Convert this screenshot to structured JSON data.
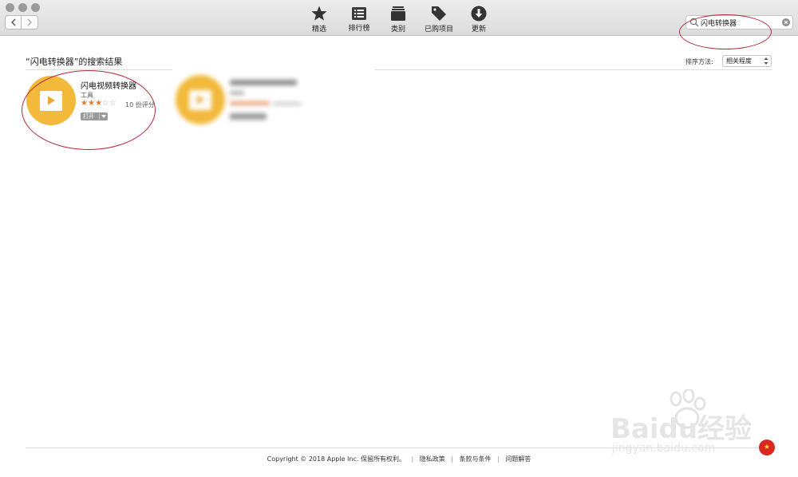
{
  "toolbar": {
    "items": [
      {
        "label": "精选",
        "icon": "star-icon"
      },
      {
        "label": "排行榜",
        "icon": "list-icon"
      },
      {
        "label": "类别",
        "icon": "stack-icon"
      },
      {
        "label": "已购项目",
        "icon": "tag-icon"
      },
      {
        "label": "更新",
        "icon": "download-icon"
      }
    ]
  },
  "search": {
    "value": "闪电转换器"
  },
  "results": {
    "title": "“闪电转换器”的搜索结果",
    "sort_label": "排序方法:",
    "sort_value": "相关程度"
  },
  "app": {
    "name": "闪电视频转换器",
    "category": "工具",
    "rating_stars": 3,
    "rating_max": 5,
    "rating_count": "10 份评分",
    "open_label": "打开",
    "icon": "play-icon",
    "icon_color": "#f2b93a"
  },
  "footer": {
    "copyright": "Copyright © 2018 Apple Inc. 保留所有权利。",
    "links": [
      "隐私政策",
      "条款与条件",
      "问题解答"
    ]
  },
  "watermark": {
    "logo": "Baidu经验",
    "url": "jingyan.baidu.com"
  },
  "colors": {
    "annotation": "#b02a3a",
    "rating_star": "#e07b33",
    "flag": "#d8281f"
  }
}
